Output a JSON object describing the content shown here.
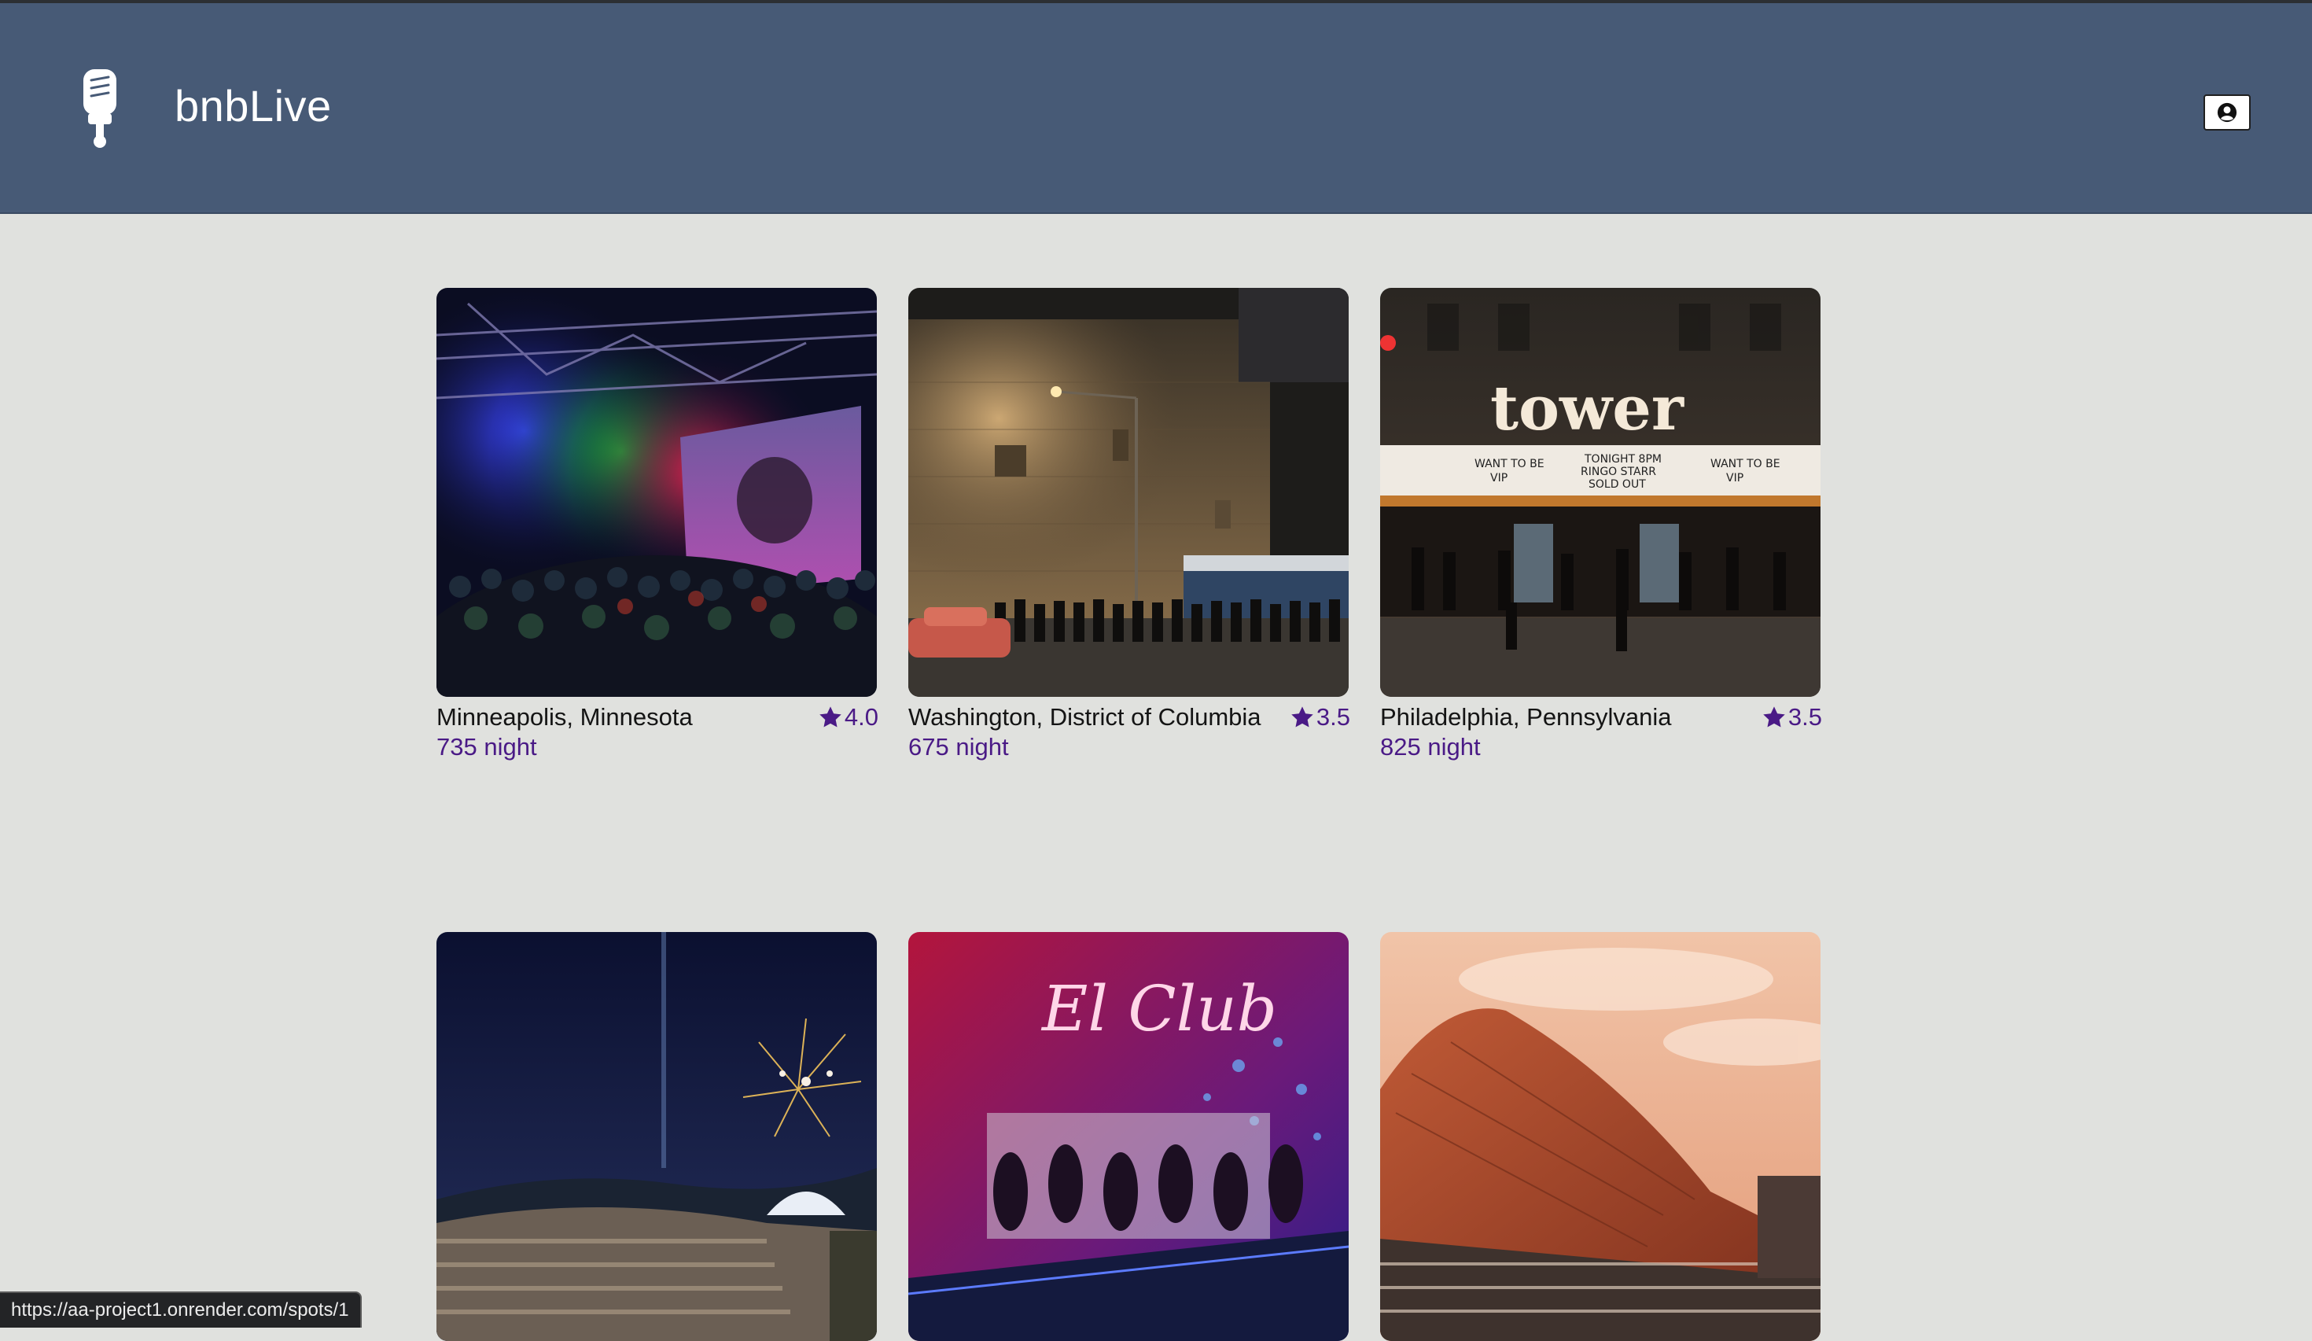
{
  "header": {
    "brand": "bnbLive"
  },
  "spots": [
    {
      "location": "Minneapolis, Minnesota",
      "rating": "4.0",
      "price": "735 night"
    },
    {
      "location": "Washington, District of Columbia",
      "rating": "3.5",
      "price": "675 night"
    },
    {
      "location": "Philadelphia, Pennsylvania",
      "rating": "3.5",
      "price": "825 night"
    },
    {
      "location": "",
      "rating": "",
      "price": ""
    },
    {
      "location": "",
      "rating": "",
      "price": ""
    },
    {
      "location": "",
      "rating": "",
      "price": ""
    }
  ],
  "status_bar": {
    "url": "https://aa-project1.onrender.com/spots/1"
  },
  "colors": {
    "header_bg": "#475a76",
    "page_bg": "#e0e1de",
    "accent": "#4a1a86"
  },
  "icons": {
    "logo": "microphone-icon",
    "profile": "user-circle-icon",
    "rating": "star-icon"
  }
}
